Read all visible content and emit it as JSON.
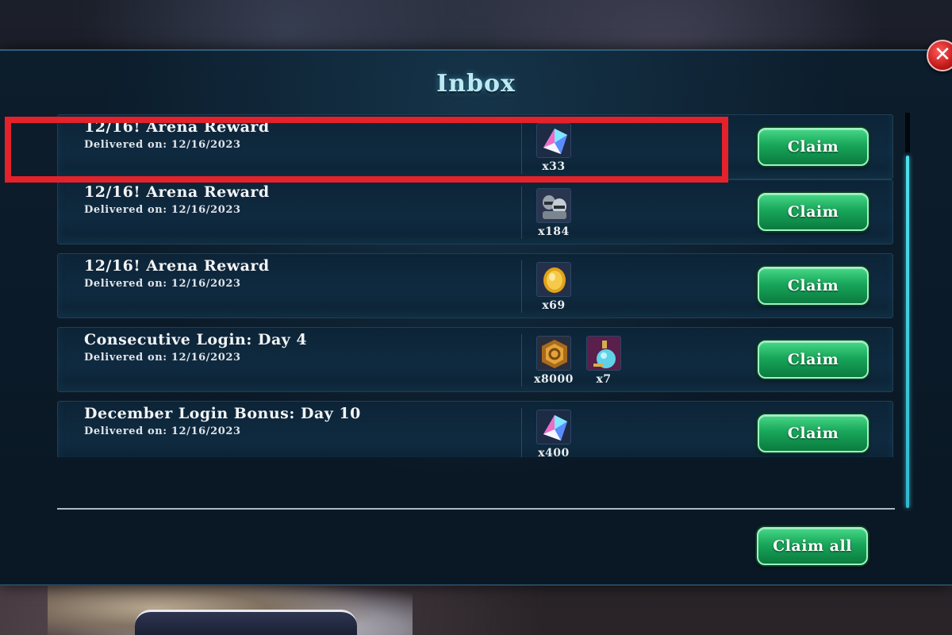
{
  "window": {
    "title": "Inbox"
  },
  "messages": [
    {
      "title": "12/16! Arena Reward",
      "delivered": "Delivered on: 12/16/2023",
      "rewards": [
        {
          "icon": "crystal-icon",
          "count": "x33"
        }
      ],
      "claim_label": "Claim"
    },
    {
      "title": "12/16! Arena Reward",
      "delivered": "Delivered on: 12/16/2023",
      "rewards": [
        {
          "icon": "helmet-tokens-icon",
          "count": "x184"
        }
      ],
      "claim_label": "Claim"
    },
    {
      "title": "12/16! Arena Reward",
      "delivered": "Delivered on: 12/16/2023",
      "rewards": [
        {
          "icon": "gold-coin-icon",
          "count": "x69"
        }
      ],
      "claim_label": "Claim"
    },
    {
      "title": "Consecutive Login: Day 4",
      "delivered": "Delivered on: 12/16/2023",
      "rewards": [
        {
          "icon": "bronze-medal-icon",
          "count": "x8000"
        },
        {
          "icon": "potion-icon",
          "count": "x7"
        }
      ],
      "claim_label": "Claim"
    },
    {
      "title": "December Login Bonus: Day 10",
      "delivered": "Delivered on: 12/16/2023",
      "rewards": [
        {
          "icon": "crystal-icon",
          "count": "x400"
        }
      ],
      "claim_label": "Claim"
    }
  ],
  "footer": {
    "claim_all_label": "Claim all"
  },
  "close_glyph": "✕",
  "colors": {
    "claim_green": "#18a65a",
    "title_cyan": "#bde9f4",
    "highlight_red": "#e4222b"
  },
  "scroll": {
    "position_fraction": 0.0
  }
}
